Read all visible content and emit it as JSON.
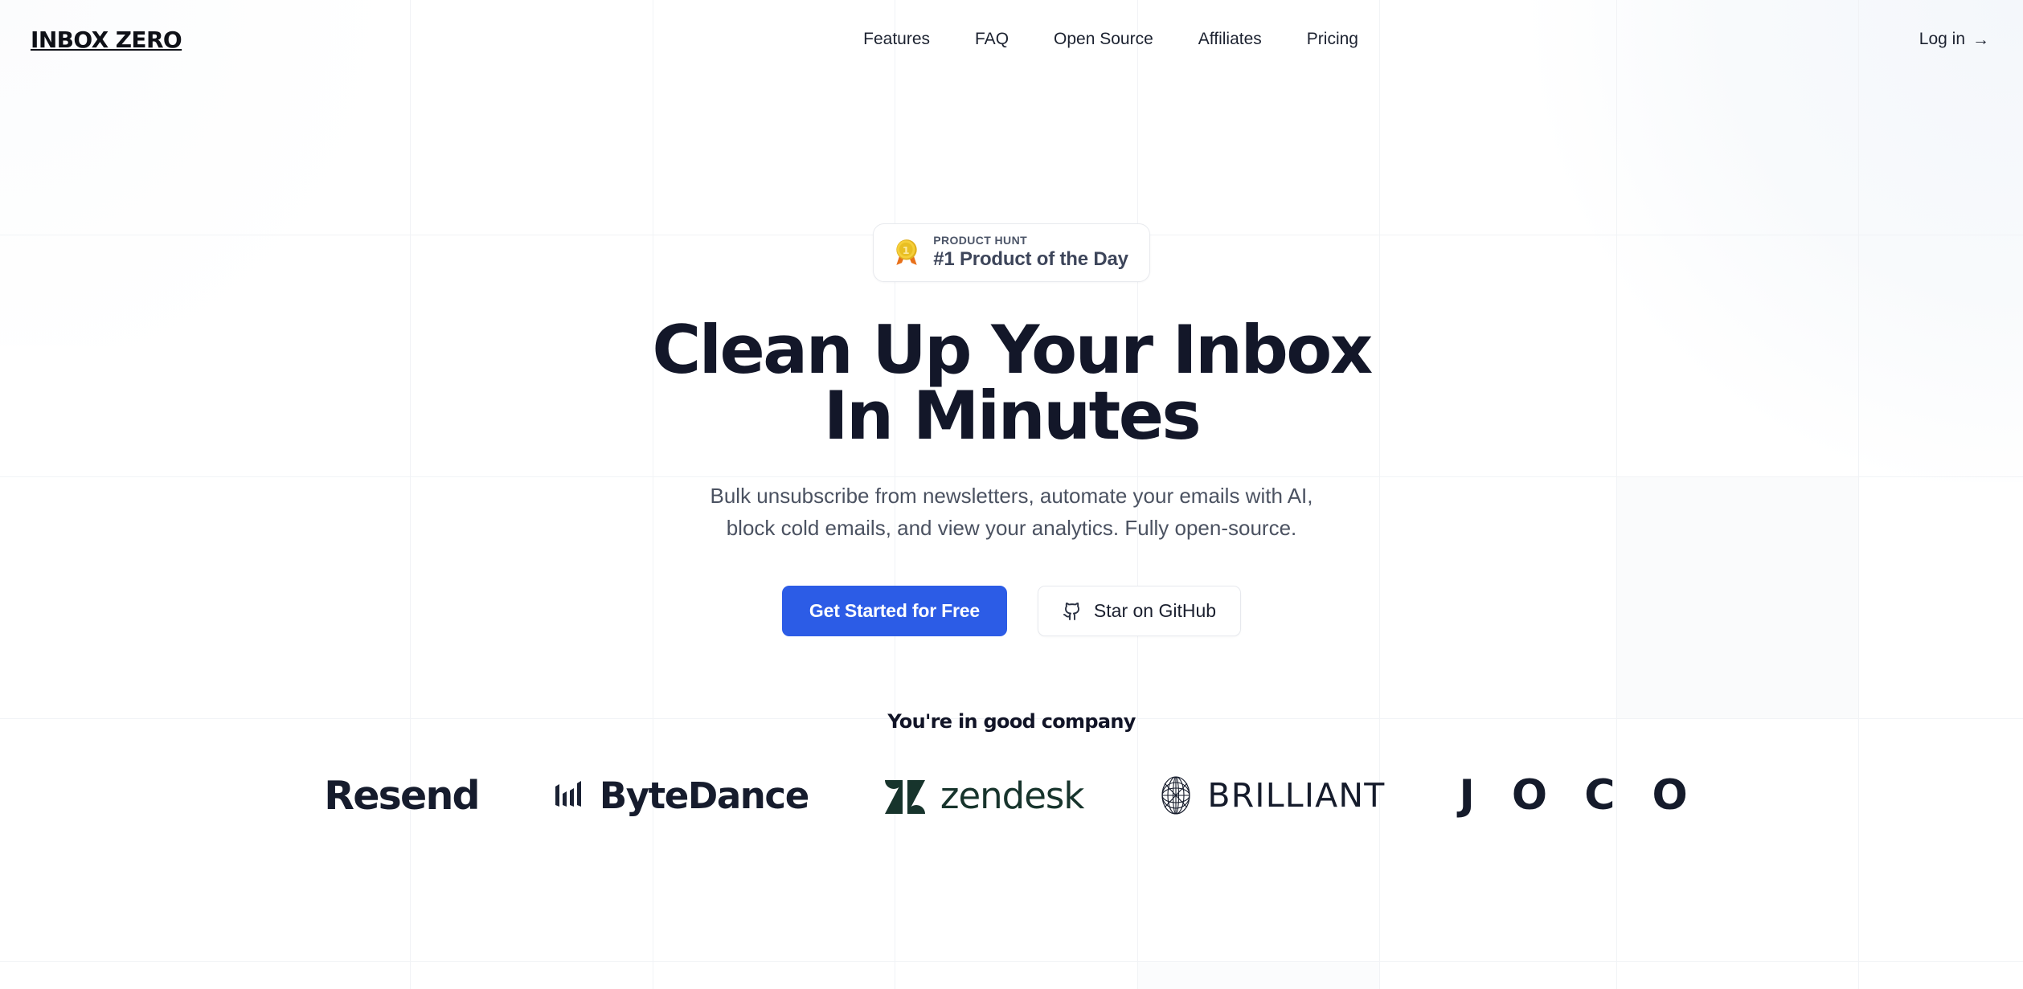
{
  "header": {
    "brand": "INBOX ZERO",
    "nav": [
      {
        "label": "Features"
      },
      {
        "label": "FAQ"
      },
      {
        "label": "Open Source"
      },
      {
        "label": "Affiliates"
      },
      {
        "label": "Pricing"
      }
    ],
    "login_label": "Log in",
    "login_arrow": "→"
  },
  "hero": {
    "badge": {
      "icon": "gold-medal-icon",
      "eyebrow": "PRODUCT HUNT",
      "title": "#1 Product of the Day"
    },
    "headline_line1": "Clean Up Your Inbox",
    "headline_line2": "In Minutes",
    "subhead_line1": "Bulk unsubscribe from newsletters, automate your emails with AI,",
    "subhead_line2": "block cold emails, and view your analytics. Fully open-source.",
    "cta_primary": "Get Started for Free",
    "cta_secondary": "Star on GitHub",
    "cta_secondary_icon": "github-icon"
  },
  "social_proof": {
    "title": "You're in good company",
    "companies": [
      {
        "name": "Resend",
        "mark": "none"
      },
      {
        "name": "ByteDance",
        "mark": "bars-icon"
      },
      {
        "name": "zendesk",
        "mark": "zendesk-z-icon"
      },
      {
        "name": "BRILLIANT",
        "mark": "gem-icon"
      },
      {
        "name": "J O C O",
        "mark": "none"
      }
    ]
  },
  "colors": {
    "accent_blue": "#2c5ce6",
    "heading_dark": "#131729",
    "body_text": "#4b5261",
    "grid_line": "#f1f3f6",
    "zendesk_green": "#17342c",
    "medal_gold": "#f2c230",
    "medal_ribbon": "#e8701a"
  }
}
